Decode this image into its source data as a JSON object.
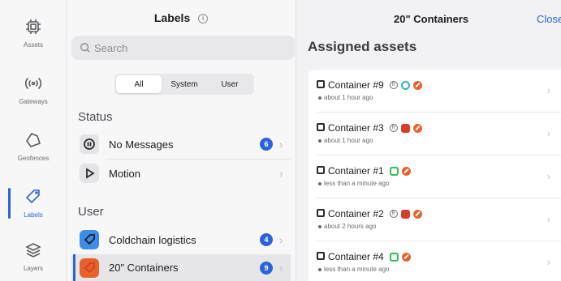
{
  "nav": {
    "items": [
      {
        "label": "Assets",
        "icon": "chip-icon"
      },
      {
        "label": "Gateways",
        "icon": "signal-icon"
      },
      {
        "label": "Geofences",
        "icon": "geofence-icon"
      },
      {
        "label": "Labels",
        "icon": "tag-icon"
      },
      {
        "label": "Layers",
        "icon": "layers-icon"
      }
    ],
    "active": "Labels"
  },
  "labels": {
    "title": "Labels",
    "info": "i",
    "search_placeholder": "Search",
    "filters": [
      "All",
      "System",
      "User"
    ],
    "active_filter": "All",
    "status_heading": "Status",
    "status_items": [
      {
        "label": "No Messages",
        "count": "6",
        "icon": "pause-icon"
      },
      {
        "label": "Motion",
        "count": "",
        "icon": "play-icon"
      }
    ],
    "user_heading": "User",
    "user_items": [
      {
        "label": "Coldchain logistics",
        "count": "4",
        "icon": "tag-icon"
      },
      {
        "label": "20\" Containers",
        "count": "9",
        "icon": "tag-icon",
        "selected": true
      }
    ]
  },
  "assets": {
    "title": "20\" Containers",
    "close_label": "Close",
    "heading": "Assigned assets",
    "rows": [
      {
        "name": "Container #9",
        "time": "about 1 hour ago",
        "tags": [
          "r",
          "circle",
          "orange"
        ]
      },
      {
        "name": "Container #3",
        "time": "about 1 hour ago",
        "tags": [
          "r",
          "red",
          "orange"
        ]
      },
      {
        "name": "Container #1",
        "time": "less than a minute ago",
        "tags": [
          "green",
          "orange"
        ]
      },
      {
        "name": "Container #2",
        "time": "about 2 hours ago",
        "tags": [
          "r",
          "red",
          "orange"
        ]
      },
      {
        "name": "Container #4",
        "time": "less than a minute ago",
        "tags": [
          "green",
          "orange"
        ]
      }
    ]
  },
  "colors": {
    "accent": "#2b63d9",
    "tag_red": "#d63d2a",
    "tag_orange": "#e8612b",
    "tag_green": "#2fbf55",
    "tag_cyan": "#2fb5c9"
  }
}
